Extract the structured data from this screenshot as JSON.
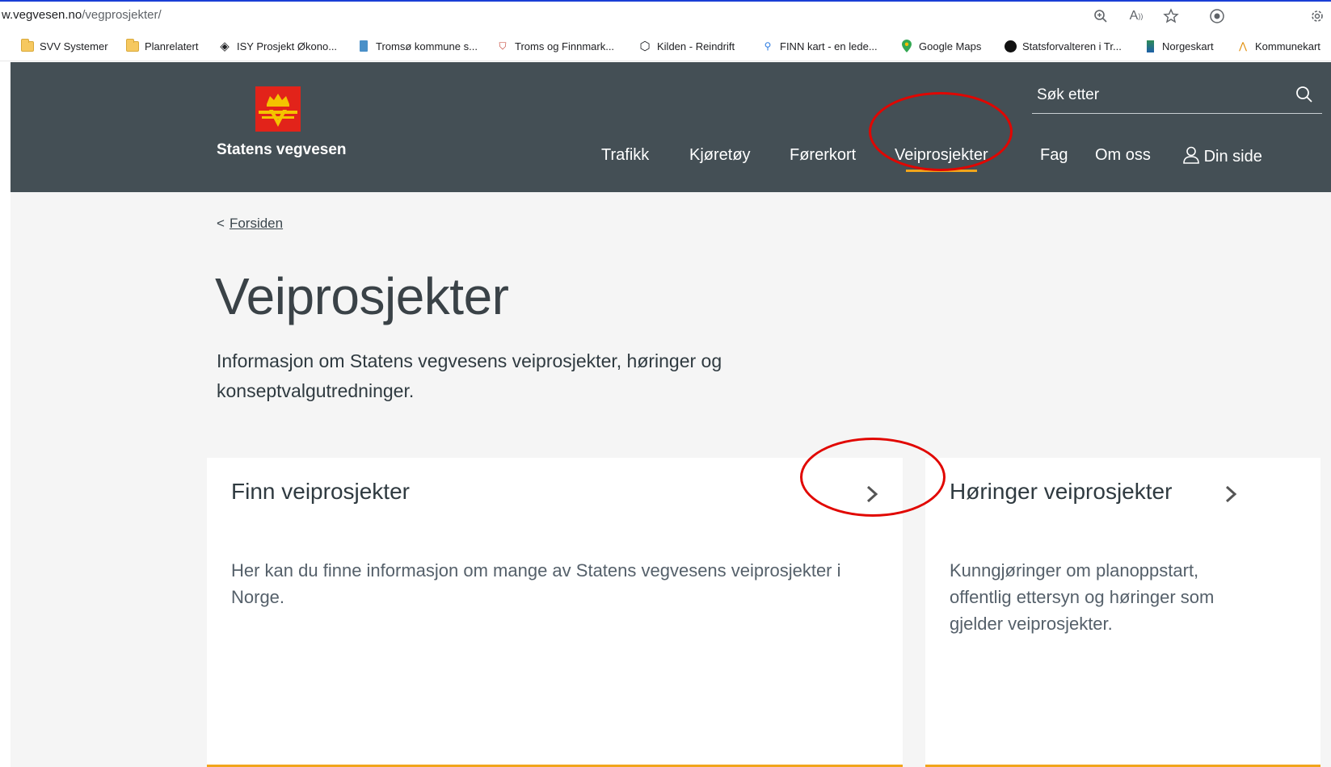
{
  "browser": {
    "url_host": "w.vegvesen.no",
    "url_path": "/vegprosjekter/",
    "toolbar_icons": [
      "zoom-icon",
      "read-aloud-icon",
      "favorite-star-icon",
      "extensions-icon",
      "settings-icon"
    ]
  },
  "bookmarks": [
    {
      "label": "SVV Systemer",
      "icon": "folder-icon"
    },
    {
      "label": "Planrelatert",
      "icon": "folder-icon"
    },
    {
      "label": "ISY Prosjekt Økono...",
      "icon": "isy-icon"
    },
    {
      "label": "Tromsø kommune s...",
      "icon": "tromso-icon"
    },
    {
      "label": "Troms og Finnmark...",
      "icon": "coat-of-arms-icon"
    },
    {
      "label": "Kilden - Reindrift",
      "icon": "kilden-icon"
    },
    {
      "label": "FINN kart - en lede...",
      "icon": "map-pin-icon"
    },
    {
      "label": "Google Maps",
      "icon": "google-maps-icon"
    },
    {
      "label": "Statsforvalteren i Tr...",
      "icon": "statsforvalteren-icon"
    },
    {
      "label": "Norgeskart",
      "icon": "norgeskart-icon"
    },
    {
      "label": "Kommunekart",
      "icon": "kommunekart-icon"
    }
  ],
  "header": {
    "brand": "Statens vegvesen",
    "search_placeholder": "Søk etter",
    "nav": [
      {
        "label": "Trafikk"
      },
      {
        "label": "Kjøretøy"
      },
      {
        "label": "Førerkort"
      },
      {
        "label": "Veiprosjekter",
        "active": true
      },
      {
        "label": "Fag"
      },
      {
        "label": "Om oss"
      },
      {
        "label": "Din side",
        "icon": "user-icon"
      }
    ]
  },
  "breadcrumb": {
    "chevron": "<",
    "label": "Forsiden"
  },
  "page": {
    "title": "Veiprosjekter",
    "intro": "Informasjon om Statens vegvesens veiprosjekter, høringer og konseptvalgutredninger."
  },
  "cards": [
    {
      "title": "Finn veiprosjekter",
      "description": "Her kan du finne informasjon om mange av Statens vegvesens veiprosjekter i Norge."
    },
    {
      "title": "Høringer veiprosjekter",
      "description": "Kunngjøringer om planoppstart, offentlig ettersyn og høringer som gjelder veiprosjekter."
    }
  ],
  "colors": {
    "header_bg": "#444f55",
    "accent": "#f1a51b",
    "annotation": "#e10600",
    "page_bg": "#f5f5f5"
  }
}
